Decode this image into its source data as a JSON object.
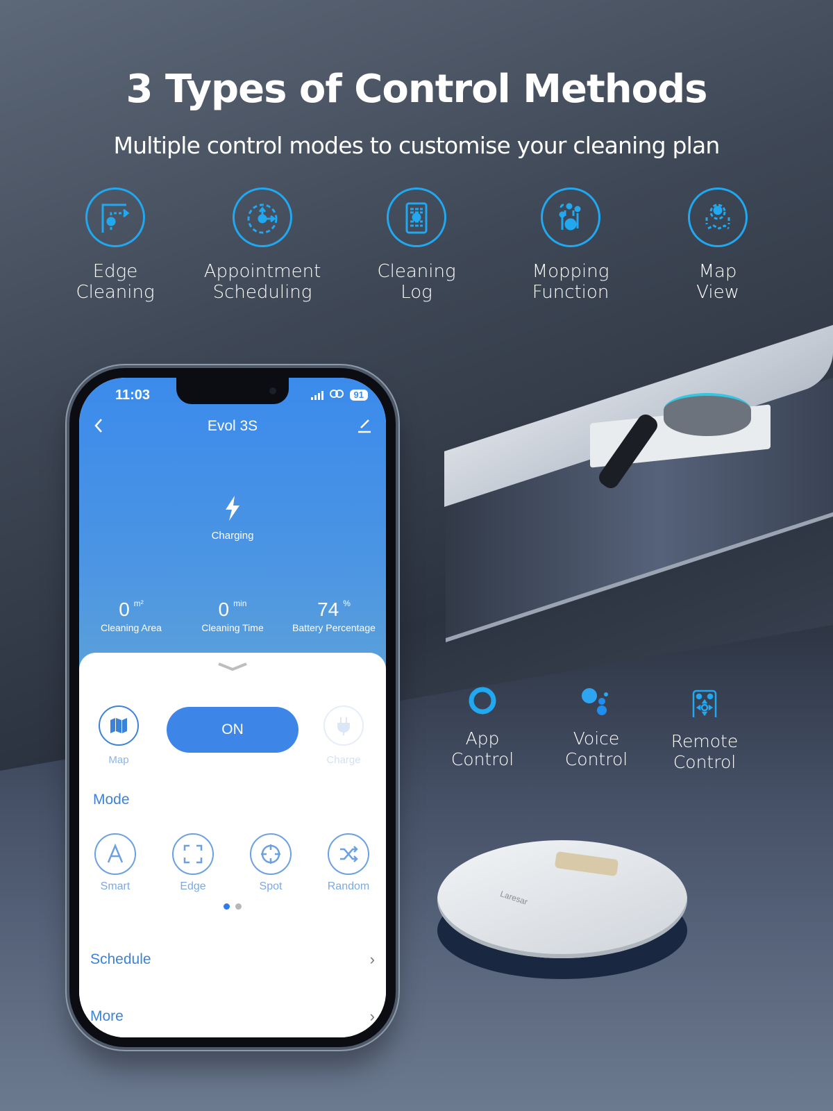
{
  "header": {
    "title": "3 Types of Control Methods",
    "subtitle": "Multiple control modes to customise your cleaning plan"
  },
  "features": [
    {
      "icon": "edge-cleaning-icon",
      "label": "Edge\nCleaning"
    },
    {
      "icon": "appointment-scheduling-icon",
      "label": "Appointment\nScheduling"
    },
    {
      "icon": "cleaning-log-icon",
      "label": "Cleaning\nLog"
    },
    {
      "icon": "mopping-function-icon",
      "label": "Mopping\nFunction"
    },
    {
      "icon": "map-view-icon",
      "label": "Map\nView"
    }
  ],
  "phone": {
    "status_bar": {
      "time": "11:03",
      "battery": "91"
    },
    "nav": {
      "title": "Evol 3S"
    },
    "device_status": "Charging",
    "stats": [
      {
        "value": "0",
        "unit": "m²",
        "label": "Cleaning Area"
      },
      {
        "value": "0",
        "unit": "min",
        "label": "Cleaning Time"
      },
      {
        "value": "74",
        "unit": "%",
        "label": "Battery Percentage"
      }
    ],
    "actions": {
      "map_label": "Map",
      "power_label": "ON",
      "charge_label": "Charge"
    },
    "mode_section_title": "Mode",
    "modes": [
      {
        "label": "Smart",
        "icon": "smart-mode-icon"
      },
      {
        "label": "Edge",
        "icon": "edge-mode-icon"
      },
      {
        "label": "Spot",
        "icon": "spot-mode-icon"
      },
      {
        "label": "Random",
        "icon": "random-mode-icon"
      }
    ],
    "pager": {
      "current": 1,
      "total": 2
    },
    "menu": [
      {
        "label": "Schedule"
      },
      {
        "label": "More"
      }
    ]
  },
  "control_methods": [
    {
      "icon": "alexa-icon",
      "label": "App\nControl"
    },
    {
      "icon": "google-assistant-icon",
      "label": "Voice\nControl"
    },
    {
      "icon": "remote-control-icon",
      "label": "Remote\nControl"
    }
  ],
  "product": {
    "brand": "Laresar"
  },
  "colors": {
    "accent": "#21a8f0",
    "app_blue": "#3d86e8"
  }
}
